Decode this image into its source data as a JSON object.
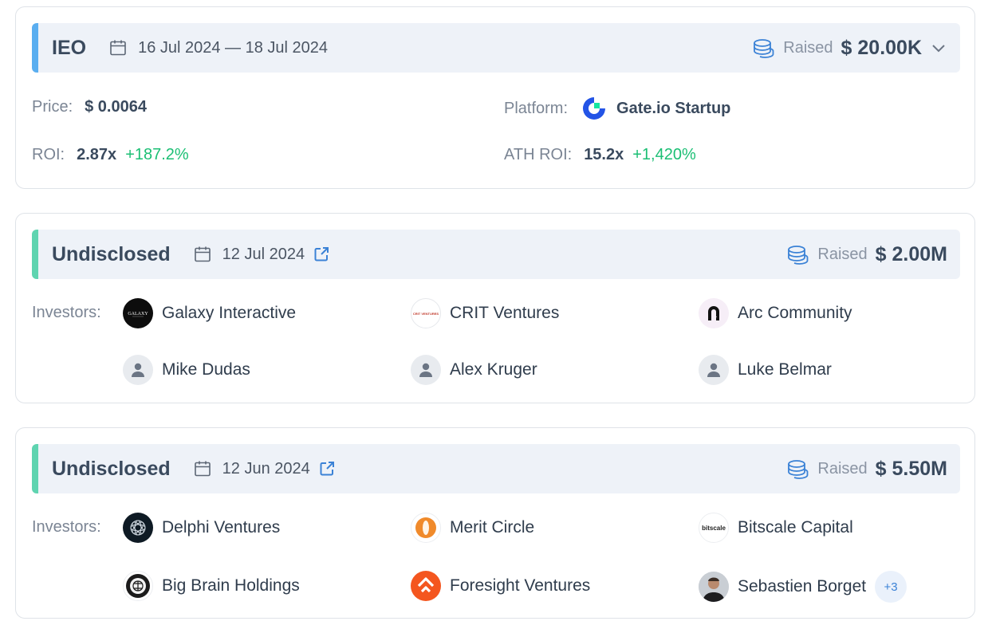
{
  "colors": {
    "ieo_accent": "#5aaef0",
    "undisclosed_accent": "#5fd4b0",
    "green": "#1bbf74",
    "link_blue": "#3b82d6"
  },
  "ieo": {
    "type": "IEO",
    "date": "16 Jul 2024 — 18 Jul 2024",
    "raised_label": "Raised",
    "raised_value": "$ 20.00K",
    "price_label": "Price:",
    "price_value": "$ 0.0064",
    "platform_label": "Platform:",
    "platform_name": "Gate.io Startup",
    "roi_label": "ROI:",
    "roi_value": "2.87x",
    "roi_change": "+187.2%",
    "ath_label": "ATH ROI:",
    "ath_value": "15.2x",
    "ath_change": "+1,420%"
  },
  "rounds": [
    {
      "type": "Undisclosed",
      "date": "12 Jul 2024",
      "raised_label": "Raised",
      "raised_value": "$ 2.00M",
      "investors_label": "Investors:",
      "investors": [
        {
          "name": "Galaxy Interactive",
          "icon": "galaxy-logo"
        },
        {
          "name": "CRIT Ventures",
          "icon": "crit-logo",
          "logo_text": "CRIT VENTURES"
        },
        {
          "name": "Arc Community",
          "icon": "arc-logo"
        },
        {
          "name": "Mike Dudas",
          "icon": "person-icon"
        },
        {
          "name": "Alex Kruger",
          "icon": "person-icon"
        },
        {
          "name": "Luke Belmar",
          "icon": "person-icon"
        }
      ]
    },
    {
      "type": "Undisclosed",
      "date": "12 Jun 2024",
      "raised_label": "Raised",
      "raised_value": "$ 5.50M",
      "investors_label": "Investors:",
      "investors": [
        {
          "name": "Delphi Ventures",
          "icon": "delphi-logo"
        },
        {
          "name": "Merit Circle",
          "icon": "merit-circle-logo"
        },
        {
          "name": "Bitscale Capital",
          "icon": "bitscale-logo",
          "logo_text": "bitscale"
        },
        {
          "name": "Big Brain Holdings",
          "icon": "big-brain-logo"
        },
        {
          "name": "Foresight Ventures",
          "icon": "foresight-logo"
        },
        {
          "name": "Sebastien Borget",
          "icon": "avatar-photo"
        }
      ],
      "more_count": "+3"
    }
  ]
}
